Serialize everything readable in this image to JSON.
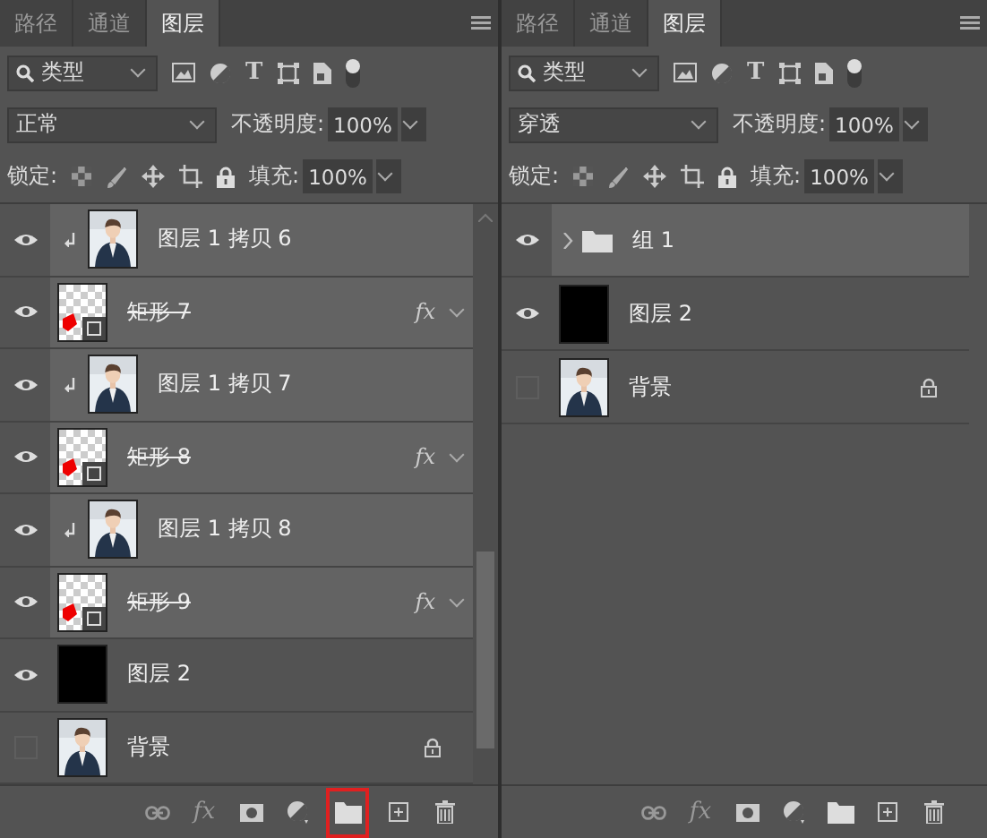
{
  "panels": [
    {
      "tabs": [
        {
          "label": "路径",
          "selected": false
        },
        {
          "label": "通道",
          "selected": false
        },
        {
          "label": "图层",
          "selected": true
        }
      ],
      "filter": {
        "value": "类型",
        "type_glyph": "T"
      },
      "blend_mode": "正常",
      "opacity": {
        "label": "不透明度:",
        "value": "100%"
      },
      "lock_label": "锁定:",
      "fill": {
        "label": "填充:",
        "value": "100%"
      },
      "scrollbar": true,
      "layers": [
        {
          "kind": "pixel",
          "name": "图层 1 拷贝 6",
          "visible": true,
          "selected": true,
          "clipped": true
        },
        {
          "kind": "shape",
          "name": "矩形 7",
          "visible": true,
          "selected": true,
          "strikethrough": true,
          "effects": "fx"
        },
        {
          "kind": "pixel",
          "name": "图层 1 拷贝 7",
          "visible": true,
          "selected": true,
          "clipped": true
        },
        {
          "kind": "shape",
          "name": "矩形 8",
          "visible": true,
          "selected": true,
          "strikethrough": true,
          "effects": "fx"
        },
        {
          "kind": "pixel",
          "name": "图层 1 拷贝 8",
          "visible": true,
          "selected": true,
          "clipped": true
        },
        {
          "kind": "shape",
          "name": "矩形 9",
          "visible": true,
          "selected": true,
          "strikethrough": true,
          "effects": "fx"
        },
        {
          "kind": "solid",
          "name": "图层 2",
          "visible": true,
          "selected": false
        },
        {
          "kind": "pixel",
          "name": "背景",
          "visible": false,
          "selected": false,
          "locked": true
        }
      ],
      "footer": [
        {
          "kind": "link",
          "highlighted": false
        },
        {
          "kind": "fx",
          "label": "fx",
          "highlighted": false
        },
        {
          "kind": "mask",
          "highlighted": false
        },
        {
          "kind": "adjust",
          "highlighted": false
        },
        {
          "kind": "group",
          "highlighted": true
        },
        {
          "kind": "new",
          "highlighted": false
        },
        {
          "kind": "delete",
          "highlighted": false
        }
      ]
    },
    {
      "tabs": [
        {
          "label": "路径",
          "selected": false
        },
        {
          "label": "通道",
          "selected": false
        },
        {
          "label": "图层",
          "selected": true
        }
      ],
      "filter": {
        "value": "类型",
        "type_glyph": "T"
      },
      "blend_mode": "穿透",
      "opacity": {
        "label": "不透明度:",
        "value": "100%"
      },
      "lock_label": "锁定:",
      "fill": {
        "label": "填充:",
        "value": "100%"
      },
      "scrollbar": false,
      "layers": [
        {
          "kind": "group",
          "name": "组 1",
          "visible": true,
          "selected": true,
          "expanded": false
        },
        {
          "kind": "solid",
          "name": "图层 2",
          "visible": true,
          "selected": false
        },
        {
          "kind": "pixel",
          "name": "背景",
          "visible": false,
          "selected": false,
          "locked": true
        }
      ],
      "footer": [
        {
          "kind": "link",
          "highlighted": false
        },
        {
          "kind": "fx",
          "label": "fx",
          "highlighted": false
        },
        {
          "kind": "mask",
          "highlighted": false
        },
        {
          "kind": "adjust",
          "highlighted": false
        },
        {
          "kind": "group",
          "highlighted": false
        },
        {
          "kind": "new",
          "highlighted": false
        },
        {
          "kind": "delete",
          "highlighted": false
        }
      ]
    }
  ]
}
